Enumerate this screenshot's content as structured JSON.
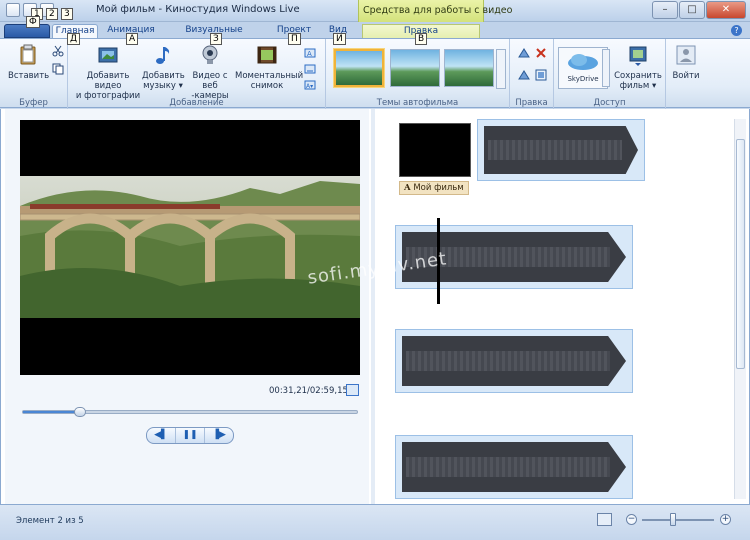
{
  "window": {
    "title": "Мой фильм - Киностудия Windows Live",
    "context_title": "Средства для работы с видео",
    "controls": [
      "–",
      "□",
      "✕"
    ]
  },
  "qat": {
    "keytips": [
      "1",
      "2",
      "3"
    ],
    "app_keytip": "Ф"
  },
  "tabs": [
    {
      "label": "Главная",
      "keytip": "Д",
      "active": true
    },
    {
      "label": "Анимация",
      "keytip": "А"
    },
    {
      "label": "Визуальные эффекты",
      "keytip": "З"
    },
    {
      "label": "Проект",
      "keytip": "П"
    },
    {
      "label": "Вид",
      "keytip": "И"
    },
    {
      "label": "Правка",
      "keytip": "В",
      "contextual": true
    }
  ],
  "ribbon": {
    "clipboard": {
      "label": "Буфер",
      "paste": "Вставить"
    },
    "add": {
      "label": "Добавление",
      "add_video_l1": "Добавить видео",
      "add_video_l2": "и фотографии",
      "add_music_l1": "Добавить",
      "add_music_l2": "музыку ▾",
      "webcam_l1": "Видео с веб",
      "webcam_l2": "-камеры",
      "snapshot_l1": "Моментальный",
      "snapshot_l2": "снимок"
    },
    "themes": {
      "label": "Темы автофильма"
    },
    "edit": {
      "label": "Правка"
    },
    "share": {
      "label": "Доступ",
      "skydrive": "SkyDrive",
      "save_l1": "Сохранить",
      "save_l2": "фильм ▾"
    },
    "signin": {
      "label": "Войти"
    }
  },
  "preview": {
    "time": "00:31,21/02:59,15",
    "progress": 0.17,
    "controls": [
      "◀▌",
      "❚❚",
      "▐▶"
    ]
  },
  "storyboard": {
    "caption": "Мой фильм",
    "caption_icon": "A",
    "watermark": "sofi.mydiv.net"
  },
  "status": {
    "text": "Элемент 2 из 5",
    "zoom_minus": "−",
    "zoom_plus": "+"
  }
}
